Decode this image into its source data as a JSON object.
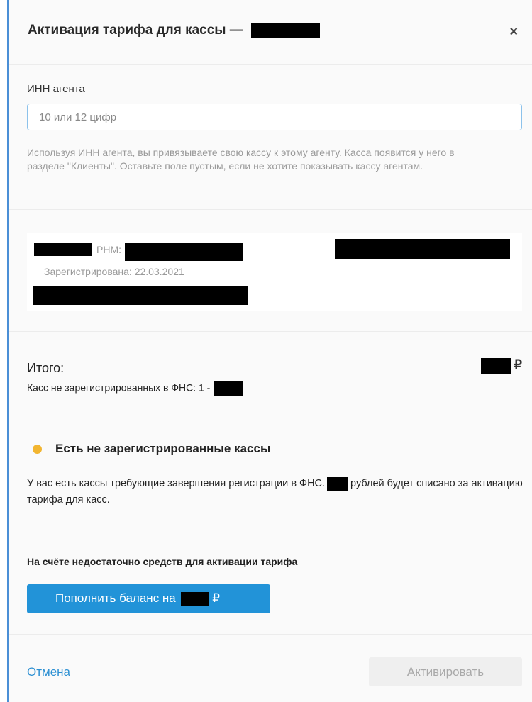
{
  "header": {
    "title": "Активация тарифа для кассы —",
    "close_icon": "×"
  },
  "agent": {
    "label": "ИНН агента",
    "placeholder": "10 или 12 цифр",
    "value": "",
    "hint": "Используя ИНН агента, вы привязываете свою кассу к этому агенту. Касса появится у него в разделе \"Клиенты\". Оставьте поле пустым, если не хотите показывать кассу агентам."
  },
  "device": {
    "rnm_label": "РНМ:",
    "registered": "Зарегистрирована: 22.03.2021"
  },
  "total": {
    "label": "Итого:",
    "currency": "₽",
    "unregistered": "Касс не зарегистрированных в ФНС: 1 -"
  },
  "warning": {
    "icon": "warning-dot-icon",
    "title": "Есть не зарегистрированные кассы",
    "text_before": "У вас есть кассы требующие завершения регистрации в ФНС.",
    "text_after": "рублей будет списано за активацию тарифа для касс."
  },
  "balance": {
    "notice": "На счёте недостаточно средств для активации тарифа",
    "topup_label": "Пополнить баланс на",
    "currency": "₽"
  },
  "footer": {
    "cancel_label": "Отмена",
    "activate_label": "Активировать"
  },
  "colors": {
    "accent": "#2293d8",
    "warning": "#f2b530",
    "link": "#2b8fd2"
  }
}
